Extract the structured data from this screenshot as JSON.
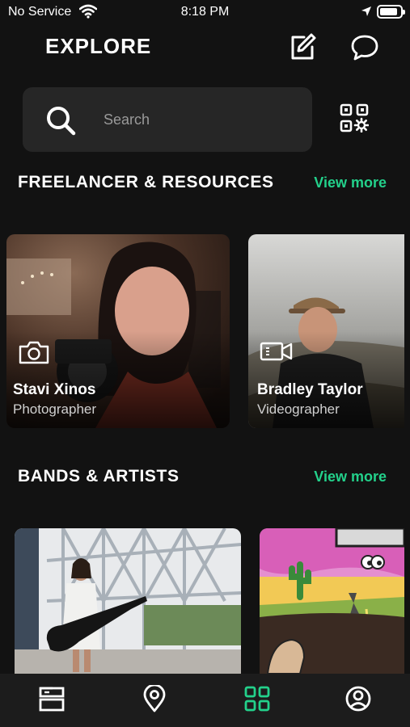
{
  "status": {
    "carrier": "No Service",
    "time": "8:18 PM"
  },
  "header": {
    "title": "EXPLORE"
  },
  "search": {
    "placeholder": "Search"
  },
  "sections": [
    {
      "title": "FREELANCER & RESOURCES",
      "view_more": "View more",
      "cards": [
        {
          "name": "Stavi Xinos",
          "role": "Photographer",
          "role_icon": "camera-icon"
        },
        {
          "name": "Bradley Taylor",
          "role": "Videographer",
          "role_icon": "video-camera-icon"
        }
      ]
    },
    {
      "title": "BANDS & ARTISTS",
      "view_more": "View more",
      "cards": [
        {
          "image": "guitarist-on-bridge"
        },
        {
          "image": "cartoon-desert-drive"
        }
      ]
    }
  ],
  "tab_bar": {
    "active_color": "#23d18b",
    "tabs": [
      {
        "icon": "feed-icon",
        "active": false
      },
      {
        "icon": "location-pin-icon",
        "active": false
      },
      {
        "icon": "grid-icon",
        "active": true
      },
      {
        "icon": "profile-icon",
        "active": false
      }
    ]
  },
  "colors": {
    "accent": "#23d18b",
    "background": "#121212",
    "search_bg": "#262626"
  }
}
